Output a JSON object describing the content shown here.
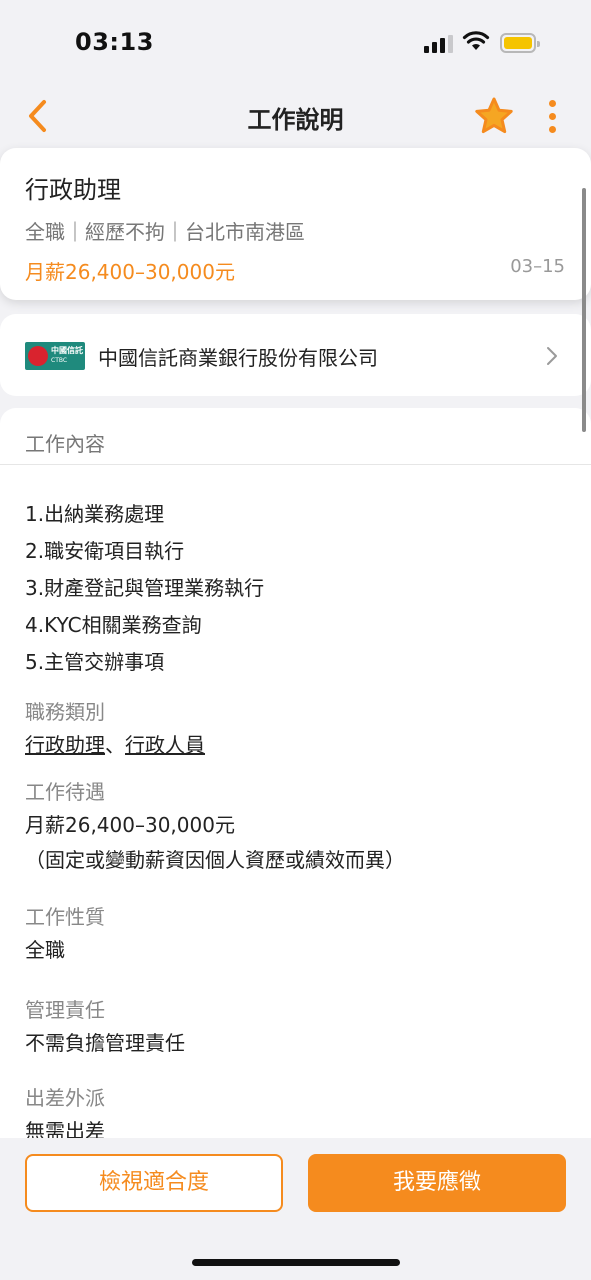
{
  "status_bar": {
    "time": "03:13"
  },
  "nav": {
    "title": "工作說明"
  },
  "job": {
    "title": "行政助理",
    "meta": "全職｜經歷不拘｜台北市南港區",
    "salary": "月薪26,400–30,000元",
    "date": "03–15"
  },
  "company": {
    "logo_text_zh": "中國信託",
    "logo_text_en": "CTBC",
    "name": "中國信託商業銀行股份有限公司"
  },
  "content": {
    "section_title": "工作內容",
    "duties": [
      "1.出納業務處理",
      "2.職安衛項目執行",
      "3.財產登記與管理業務執行",
      "4.KYC相關業務查詢",
      "5.主管交辦事項"
    ],
    "category": {
      "label": "職務類別",
      "link1": "行政助理",
      "separator": "、",
      "link2": "行政人員"
    },
    "pay": {
      "label": "工作待遇",
      "line1": "月薪26,400–30,000元",
      "line2": "（固定或變動薪資因個人資歷或績效而異）"
    },
    "nature": {
      "label": "工作性質",
      "value": "全職"
    },
    "management": {
      "label": "管理責任",
      "value": "不需負擔管理責任"
    },
    "travel": {
      "label": "出差外派",
      "value": "無需出差"
    }
  },
  "actions": {
    "check_fit": "檢視適合度",
    "apply": "我要應徵"
  },
  "colors": {
    "accent": "#f58b1e",
    "background": "#f2f2f5",
    "logo_green": "#1f8a7d",
    "logo_red": "#d9232e"
  }
}
